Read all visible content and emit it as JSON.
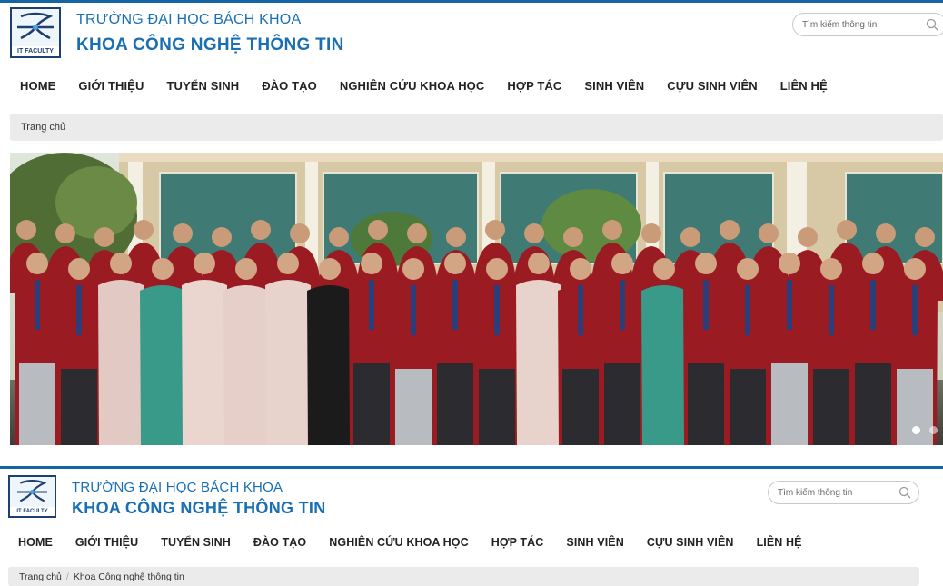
{
  "header": {
    "university": "TRƯỜNG ĐẠI HỌC BÁCH KHOA",
    "faculty": "KHOA CÔNG NGHỆ THÔNG TIN",
    "logo_caption": "IT FACULTY",
    "search_placeholder": "Tìm kiếm thông tin",
    "search_icon": "search-icon"
  },
  "nav": {
    "items": [
      "HOME",
      "GIỚI THIỆU",
      "TUYỂN SINH",
      "ĐÀO TẠO",
      "NGHIÊN CỨU KHOA HỌC",
      "HỢP TÁC",
      "SINH VIÊN",
      "CỰU SINH VIÊN",
      "LIÊN HỆ"
    ]
  },
  "breadcrumb_top": {
    "home": "Trang chủ"
  },
  "breadcrumb_bottom": {
    "home": "Trang chủ",
    "separator": "/",
    "current": "Khoa Công nghệ thông tin"
  },
  "slider": {
    "slide_count": 2,
    "active_index": 0
  },
  "colors": {
    "brand_blue": "#1a6fb3",
    "top_bar": "#1565a6",
    "shirt_red": "#9b1b22",
    "breadcrumb_bg": "#ebebeb"
  }
}
